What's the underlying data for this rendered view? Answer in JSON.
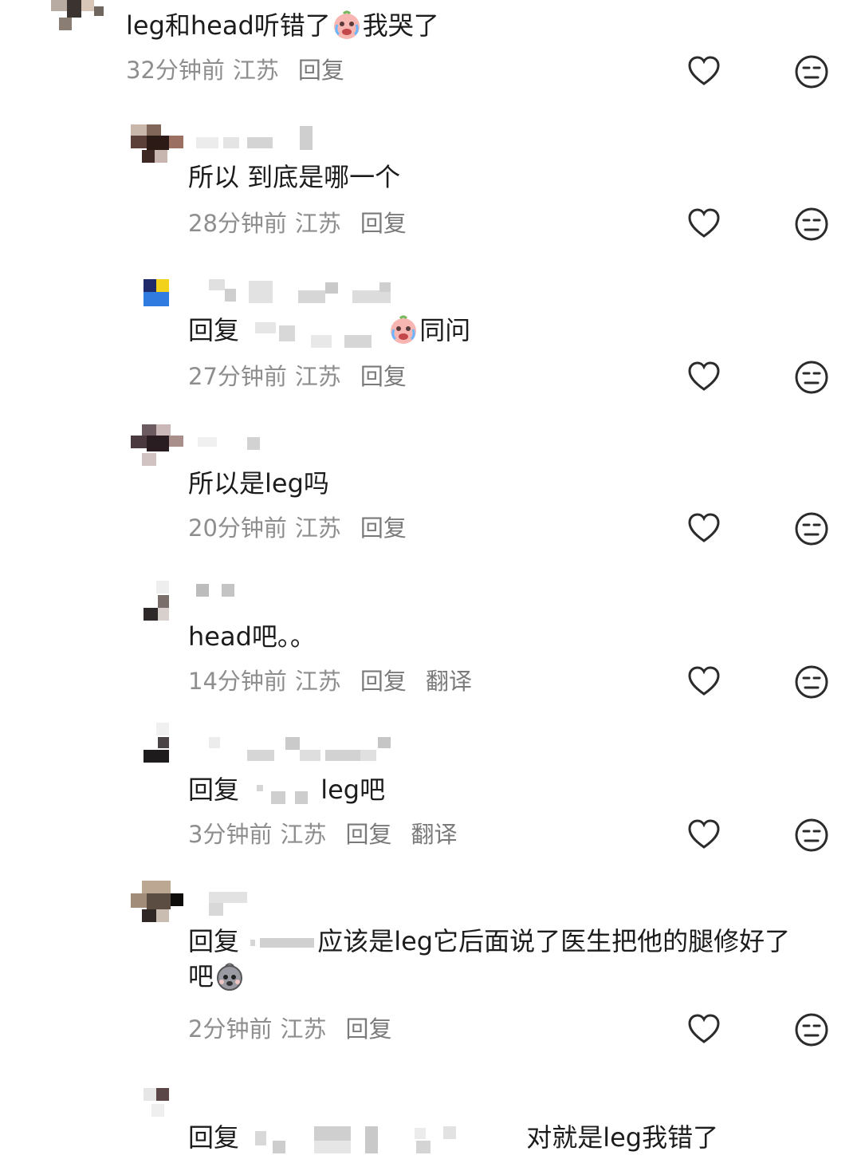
{
  "comments": [
    {
      "text": "leg和head听错了",
      "text_after_emoji": "我哭了",
      "time": "32分钟前",
      "location": "江苏",
      "reply": "回复"
    },
    {
      "text": "所以 到底是哪一个",
      "time": "28分钟前",
      "location": "江苏",
      "reply": "回复"
    },
    {
      "reply_prefix": "回复",
      "text": "同问",
      "time": "27分钟前",
      "location": "江苏",
      "reply": "回复"
    },
    {
      "text": "所以是leg吗",
      "time": "20分钟前",
      "location": "江苏",
      "reply": "回复"
    },
    {
      "text": "head吧。。",
      "time": "14分钟前",
      "location": "江苏",
      "reply": "回复",
      "translate": "翻译"
    },
    {
      "reply_prefix": "回复",
      "text": "leg吧",
      "time": "3分钟前",
      "location": "江苏",
      "reply": "回复",
      "translate": "翻译"
    },
    {
      "reply_prefix": "回复",
      "text": "应该是leg它后面说了医生把他的腿修好了",
      "text_line2": "吧",
      "time": "2分钟前",
      "location": "江苏",
      "reply": "回复"
    },
    {
      "reply_prefix": "回复",
      "text": "对就是leg我错了"
    }
  ],
  "icons": {
    "like": "heart-outline-icon",
    "dislike": "neutral-face-icon"
  },
  "colors": {
    "text": "#1c1c1c",
    "meta": "#8e8e8e",
    "icon": "#2b2b2b"
  }
}
